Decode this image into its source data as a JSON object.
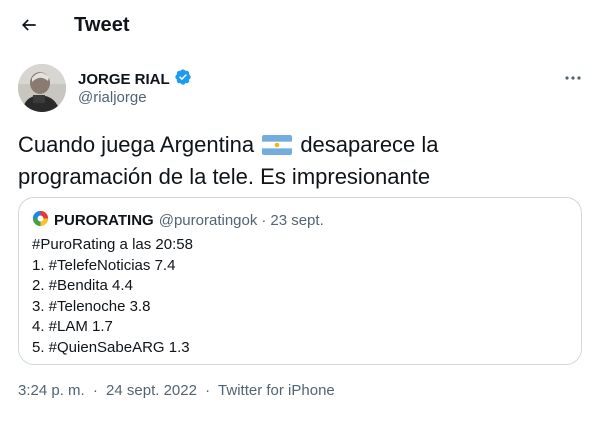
{
  "header": {
    "title": "Tweet"
  },
  "author": {
    "name": "JORGE RIAL",
    "handle": "@rialjorge",
    "verified": true
  },
  "tweet": {
    "text_before_flag": "Cuando juega Argentina ",
    "text_after_flag": " desaparece la programación de la tele. Es impresionante"
  },
  "quote": {
    "name": "PURORATING",
    "handle": "@puroratingok",
    "separator": "·",
    "date": "23 sept.",
    "lines": [
      "#PuroRating a las 20:58",
      "1. #TelefeNoticias 7.4",
      "2. #Bendita 4.4",
      "3. #Telenoche 3.8",
      "4. #LAM 1.7",
      "5. #QuienSabeARG 1.3"
    ]
  },
  "meta": {
    "time": "3:24 p. m.",
    "separator": "·",
    "date": "24 sept. 2022",
    "source": "Twitter for iPhone"
  },
  "colors": {
    "text": "#0f1419",
    "secondary": "#536471",
    "verified": "#1d9bf0",
    "border": "#cfd9de",
    "flag_blue": "#74acdf",
    "flag_sun": "#f6b40e"
  },
  "icons": {
    "back": "arrow-left-icon",
    "more": "more-horizontal-icon",
    "verified": "verified-badge-icon",
    "flag": "argentina-flag-emoji",
    "quote_logo": "purorating-logo"
  }
}
